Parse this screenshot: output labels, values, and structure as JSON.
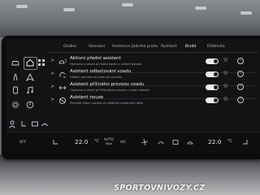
{
  "tabs": [
    {
      "label": "Osobní"
    },
    {
      "label": "Varování"
    },
    {
      "label": "Asistence jízdního pruhu"
    },
    {
      "label": "Rychlost"
    },
    {
      "label": "Brzdit"
    },
    {
      "label": "Efektivita"
    }
  ],
  "active_tab_index": 4,
  "rows": [
    {
      "title": "Aktivní přední asistent",
      "description": "Výstraha a zásah při kolizi kolem v přední oblasti",
      "icon": "car-front-assist-icon",
      "enabled": true
    },
    {
      "title": "Asistent odbočování vzadu",
      "description": "Hlídání provozu za vámi při couvání",
      "icon": "rear-turn-assist-icon",
      "enabled": true
    },
    {
      "title": "Asistent příčného provozu vzadu",
      "description": "Výstraha a zásah při křižujícím provozu v zadní oblasti",
      "icon": "cross-traffic-icon",
      "enabled": true
    },
    {
      "title": "Asistent nouze",
      "description": "Převzetí řízení vozidla při zjištěné neaktivitě řidiče",
      "icon": "emergency-assist-icon",
      "enabled": true
    }
  ],
  "climate": {
    "off_label": "OFF",
    "left_temp": "22.0",
    "auto_label": "AUTO",
    "max_label": "MAX",
    "ac_label": "A/C",
    "right_temp": "22.0"
  },
  "watermark": "SPORTOVNIVOZY.CZ"
}
